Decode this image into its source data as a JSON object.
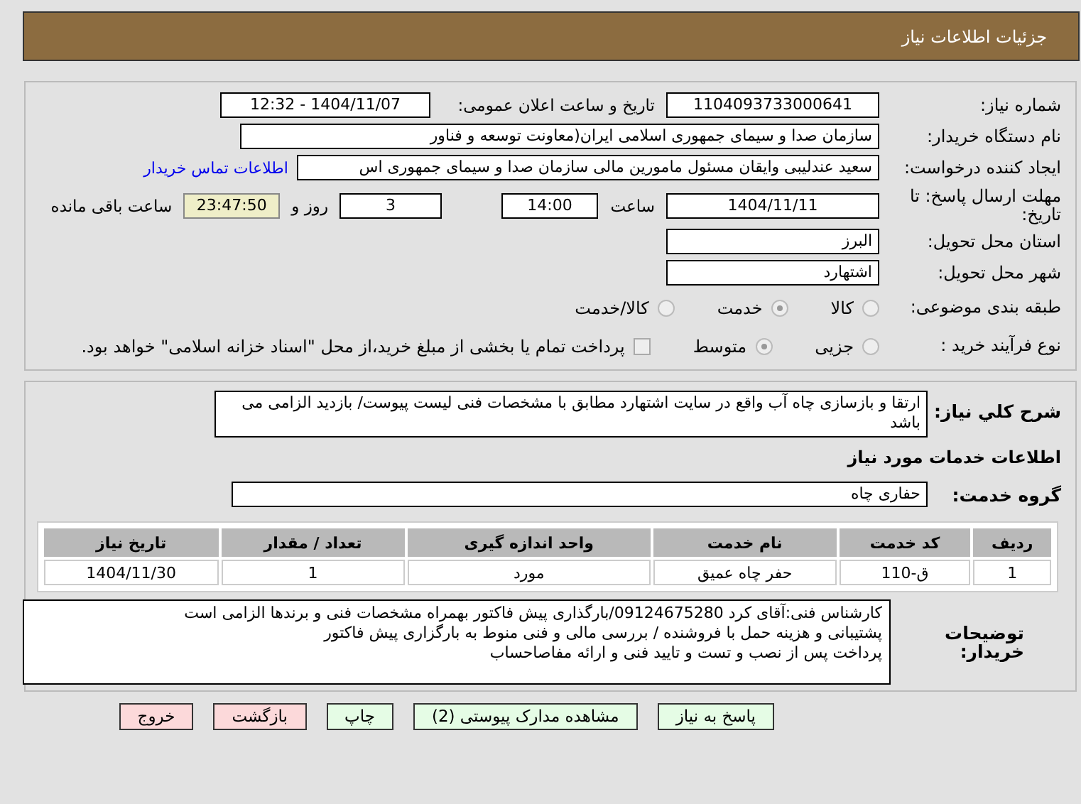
{
  "header": {
    "title": "جزئیات اطلاعات نیاز"
  },
  "need_number": {
    "label": "شماره نیاز:",
    "value": "1104093733000641"
  },
  "announce": {
    "label": "تاریخ و ساعت اعلان عمومی:",
    "value": "1404/11/07 - 12:32"
  },
  "buyer": {
    "label": "نام دستگاه خریدار:",
    "value": "سازمان صدا و سیمای جمهوری اسلامی ایران(معاونت توسعه و فناور"
  },
  "creator": {
    "label": "ایجاد کننده درخواست:",
    "value": "سعید عندلیبی وایقان مسئول مامورین مالی  سازمان صدا و سیمای جمهوری اس",
    "link": "اطلاعات تماس خریدار"
  },
  "deadline": {
    "label": "مهلت ارسال پاسخ: تا تاریخ:",
    "date": "1404/11/11",
    "time_label": "ساعت",
    "time": "14:00",
    "days": "3",
    "days_label": "روز و",
    "remaining": "23:47:50",
    "remaining_label": "ساعت باقی مانده"
  },
  "province": {
    "label": "استان محل تحویل:",
    "value": "البرز"
  },
  "city": {
    "label": "شهر محل تحویل:",
    "value": "اشتهارد"
  },
  "category": {
    "label": "طبقه بندی موضوعی:",
    "options": [
      {
        "label": "کالا",
        "selected": false
      },
      {
        "label": "خدمت",
        "selected": true
      },
      {
        "label": "کالا/خدمت",
        "selected": false
      }
    ]
  },
  "purchase_type": {
    "label": "نوع فرآیند خرید :",
    "options": [
      {
        "label": "جزیی",
        "selected": false
      },
      {
        "label": "متوسط",
        "selected": true
      }
    ],
    "treasury": {
      "label": "پرداخت تمام یا بخشی از مبلغ خرید،از محل \"اسناد خزانه اسلامی\" خواهد بود.",
      "checked": false
    }
  },
  "summary": {
    "label": "شرح کلي نیاز:",
    "value": "ارتقا و بازسازی چاه آب واقع در  سایت اشتهارد مطابق با مشخصات فنی لیست پیوست/ بازدید الزامی می باشد"
  },
  "services_title": "اطلاعات خدمات مورد نیاز",
  "service_group": {
    "label": "گروه خدمت:",
    "value": "حفاری چاه"
  },
  "table": {
    "columns": [
      "ردیف",
      "کد خدمت",
      "نام خدمت",
      "واحد اندازه گیری",
      "تعداد / مقدار",
      "تاریخ نیاز"
    ],
    "rows": [
      [
        "1",
        "ق-110",
        "حفر چاه عمیق",
        "مورد",
        "1",
        "1404/11/30"
      ]
    ]
  },
  "buyer_notes": {
    "label": "توضیحات خریدار:",
    "lines": [
      "کارشناس فنی:آقای کرد 09124675280/بارگذاری پیش فاکتور بهمراه مشخصات فنی و برندها الزامی است",
      "پشتیبانی و هزینه حمل با فروشنده / بررسی مالی و فنی منوط به بارگزاری پیش فاکتور",
      "پرداخت پس از نصب و تست و تایید فنی و ارائه مفاصاحساب"
    ]
  },
  "buttons": [
    {
      "label": "پاسخ به نیاز",
      "kind": "action"
    },
    {
      "label": "مشاهده مدارک پیوستی (2)",
      "kind": "action"
    },
    {
      "label": "چاپ",
      "kind": "action"
    },
    {
      "label": "بازگشت",
      "kind": "exit"
    },
    {
      "label": "خروج",
      "kind": "exit"
    }
  ]
}
